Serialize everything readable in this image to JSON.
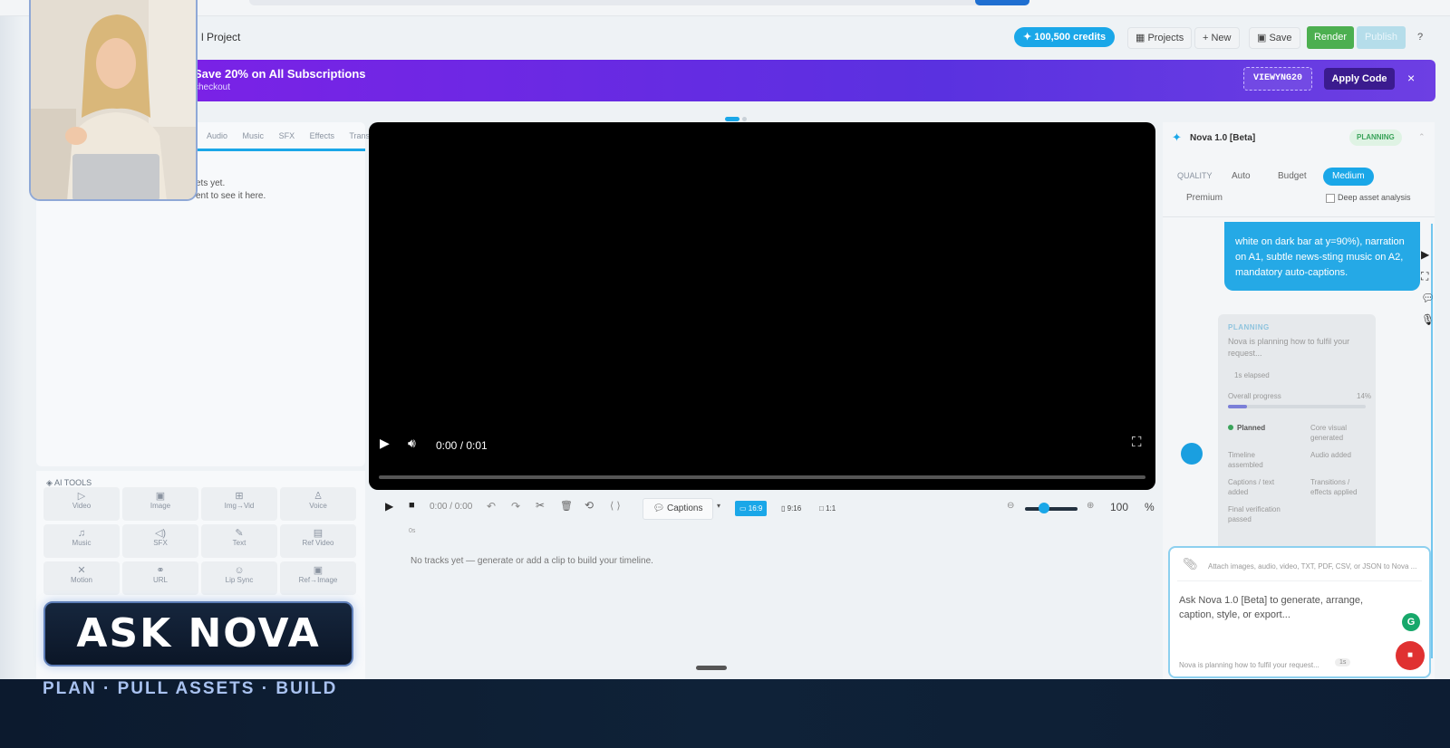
{
  "header": {
    "project_title": "l Project",
    "credits": "✦ 100,500 credits",
    "projects": "Projects",
    "new": "+ New",
    "save": "Save",
    "render": "Render",
    "publish": "Publish",
    "help": "?"
  },
  "promo": {
    "title": "Save 20% on All Subscriptions",
    "subtitle": "checkout",
    "code": "VIEWYNG20",
    "apply": "Apply Code",
    "close": "×"
  },
  "media_panel": {
    "tabs": [
      "Audio",
      "Music",
      "SFX",
      "Effects",
      "Trans"
    ],
    "empty_line1": "ets yet.",
    "empty_line2": "ent to see it here."
  },
  "ai_tools": {
    "title": "AI TOOLS",
    "tools": [
      {
        "label": "Video",
        "icon": "▷"
      },
      {
        "label": "Image",
        "icon": "▣"
      },
      {
        "label": "Img→Vid",
        "icon": "⊞"
      },
      {
        "label": "Voice",
        "icon": "♙"
      },
      {
        "label": "Music",
        "icon": "♫"
      },
      {
        "label": "SFX",
        "icon": "◁)"
      },
      {
        "label": "Text",
        "icon": "✎"
      },
      {
        "label": "Ref Video",
        "icon": "▤"
      },
      {
        "label": "Motion",
        "icon": "✕"
      },
      {
        "label": "URL",
        "icon": "⚭"
      },
      {
        "label": "Lip Sync",
        "icon": "☺"
      },
      {
        "label": "Ref→Image",
        "icon": "▣"
      }
    ]
  },
  "video": {
    "time": "0:00 / 0:01"
  },
  "timeline": {
    "time": "0:00 / 0:00",
    "captions": "Captions",
    "ratios": [
      "16:9",
      "9:16",
      "1:1"
    ],
    "zoom": "100",
    "zoom_unit": "%",
    "zero": "0s",
    "empty": "No tracks yet — generate or add a clip to build your timeline."
  },
  "assistant": {
    "title": "Nova 1.0 [Beta]",
    "status": "PLANNING",
    "quality_label": "QUALITY",
    "quality_options": [
      "Auto",
      "Budget",
      "Medium"
    ],
    "premium": "Premium",
    "deep_analysis": "Deep asset analysis",
    "message": "white on dark bar at y=90%), narration on A1, subtle news-sting music on A2, mandatory auto-captions.",
    "plan": {
      "title": "PLANNING",
      "desc": "Nova is planning how to fulfil your request...",
      "elapsed": "1s elapsed",
      "progress_label": "Overall progress",
      "progress_pct": "14%",
      "progress_value": 0.14,
      "steps": [
        {
          "label": "Planned",
          "col": 0
        },
        {
          "label": "Core visual generated",
          "col": 1
        },
        {
          "label": "Timeline assembled",
          "col": 0
        },
        {
          "label": "Audio added",
          "col": 1
        },
        {
          "label": "Captions / text added",
          "col": 0
        },
        {
          "label": "Transitions / effects applied",
          "col": 1
        },
        {
          "label": "Final verification passed",
          "col": 0
        }
      ]
    },
    "attach_hint": "Attach images, audio, video, TXT, PDF, CSV, or JSON to Nova ...",
    "prompt_placeholder": "Ask Nova 1.0 [Beta] to generate, arrange, caption, style, or export...",
    "status_line": "Nova is planning how to fulfil your request...",
    "status_badge": "1s"
  },
  "overlay": {
    "title": "ASK NOVA",
    "tagline": "PLAN · PULL ASSETS · BUILD"
  },
  "colors": {
    "accent": "#1aa7e8",
    "promo": "#6a2be4",
    "render": "#4caf50"
  }
}
